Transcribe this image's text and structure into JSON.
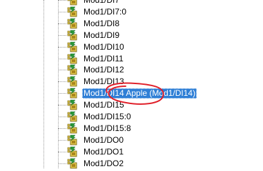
{
  "tree": {
    "items": [
      {
        "label": "Mod1/DI7",
        "selected": false
      },
      {
        "label": "Mod1/DI7:0",
        "selected": false
      },
      {
        "label": "Mod1/DI8",
        "selected": false
      },
      {
        "label": "Mod1/DI9",
        "selected": false
      },
      {
        "label": "Mod1/DI10",
        "selected": false
      },
      {
        "label": "Mod1/DI11",
        "selected": false
      },
      {
        "label": "Mod1/DI12",
        "selected": false
      },
      {
        "label": "Mod1/DI13",
        "selected": false
      },
      {
        "label": "Mod1/DI14 Apple (Mod1/DI14)",
        "selected": true
      },
      {
        "label": "Mod1/DI15",
        "selected": false
      },
      {
        "label": "Mod1/DI15:0",
        "selected": false
      },
      {
        "label": "Mod1/DI15:8",
        "selected": false
      },
      {
        "label": "Mod1/DO0",
        "selected": false
      },
      {
        "label": "Mod1/DO1",
        "selected": false
      },
      {
        "label": "Mod1/DO2",
        "selected": false
      }
    ],
    "icon": "io-node-icon"
  },
  "colors": {
    "selection": "#2f7fd6",
    "annotation": "#e0202a"
  }
}
